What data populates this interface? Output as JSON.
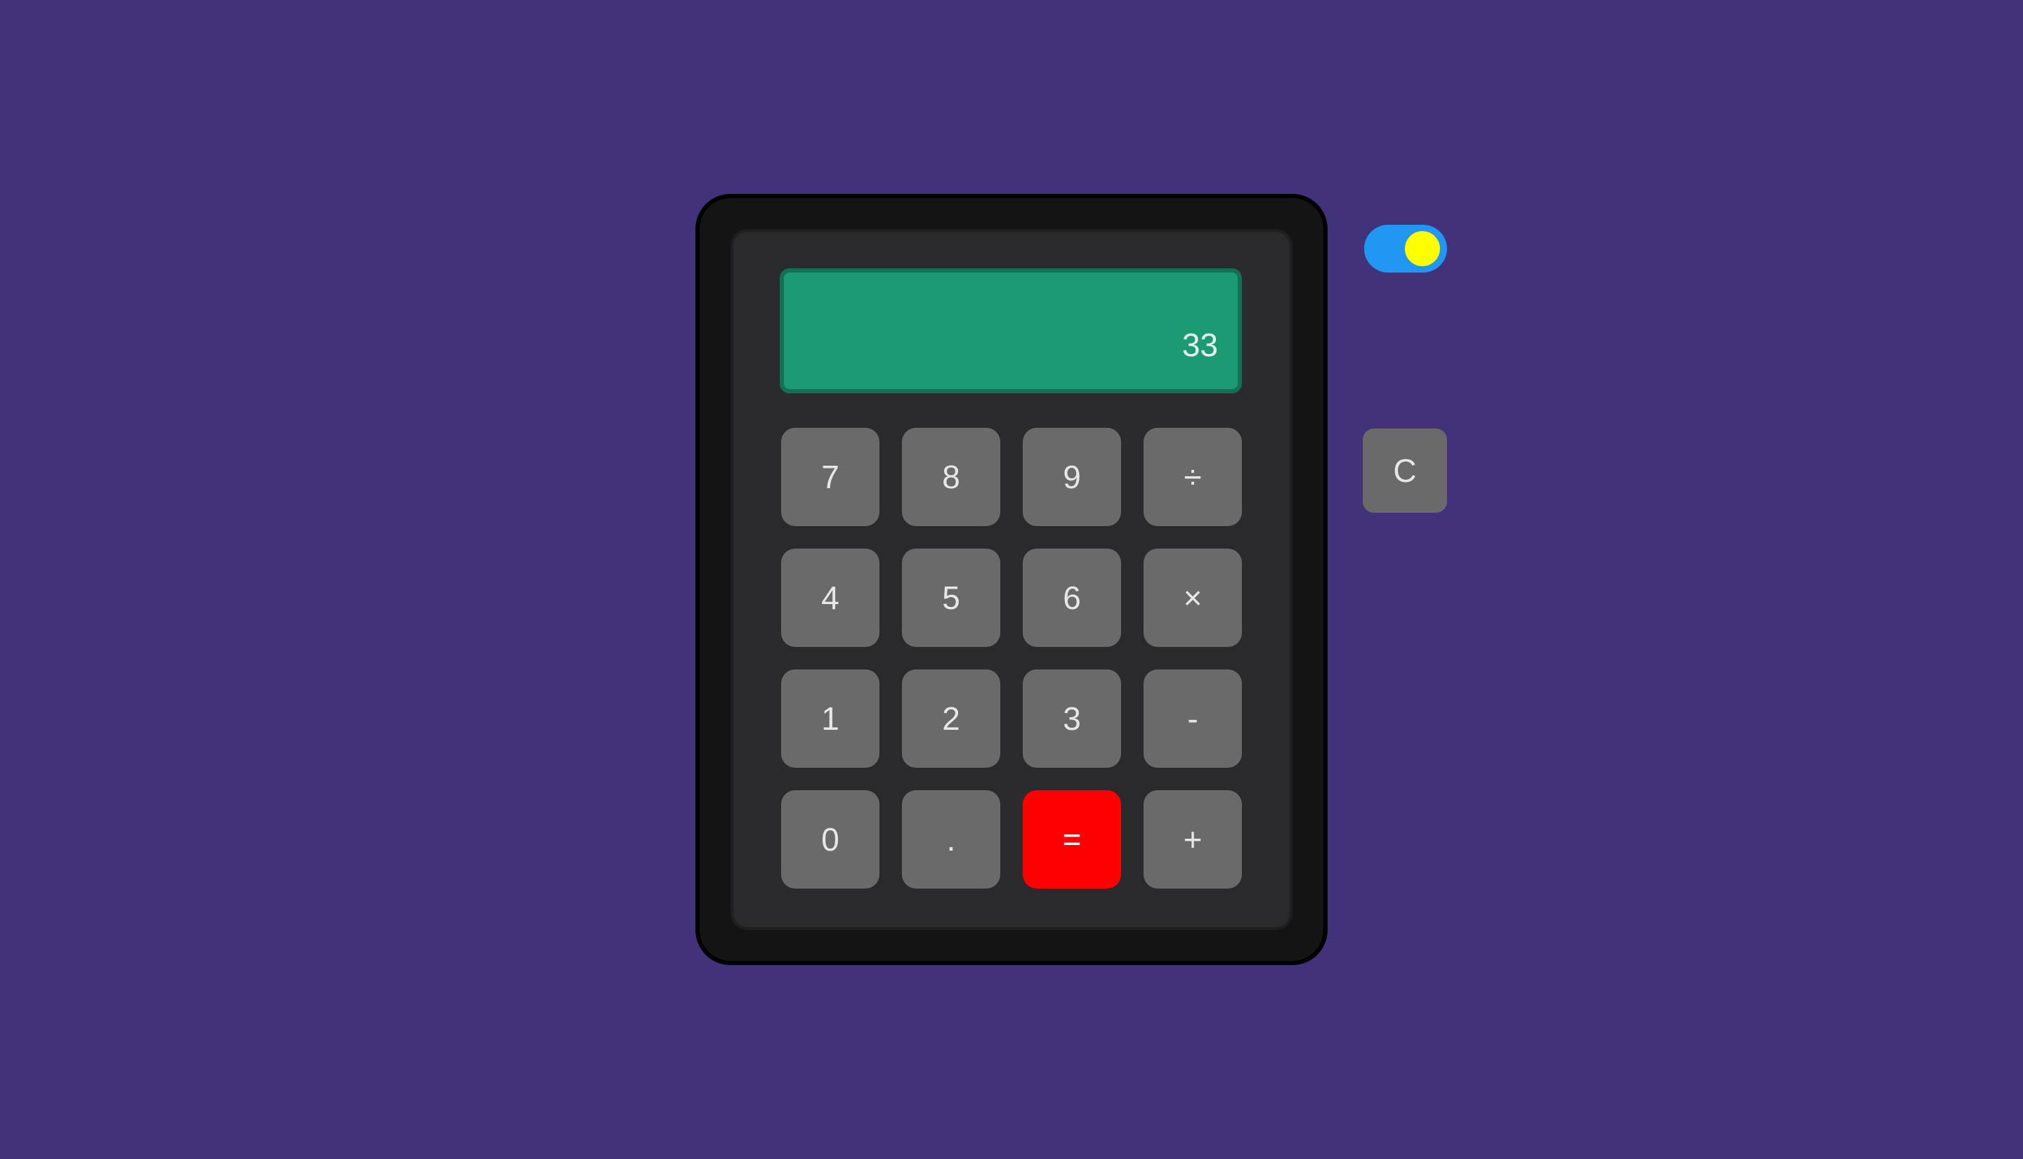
{
  "display": {
    "value": "33"
  },
  "keypad": {
    "keys": [
      {
        "label": "7"
      },
      {
        "label": "8"
      },
      {
        "label": "9"
      },
      {
        "label": "÷"
      },
      {
        "label": "4"
      },
      {
        "label": "5"
      },
      {
        "label": "6"
      },
      {
        "label": "×"
      },
      {
        "label": "1"
      },
      {
        "label": "2"
      },
      {
        "label": "3"
      },
      {
        "label": "-"
      },
      {
        "label": "0"
      },
      {
        "label": "."
      },
      {
        "label": "="
      },
      {
        "label": "+"
      }
    ]
  },
  "clear": {
    "label": "C"
  },
  "theme_toggle": {
    "on": true
  },
  "colors": {
    "background": "#42327a",
    "display": "#1c9a73",
    "key": "#6a6a6a",
    "equals_key": "#ff0000",
    "toggle_track": "#2196f3",
    "toggle_knob": "#ffff00"
  }
}
